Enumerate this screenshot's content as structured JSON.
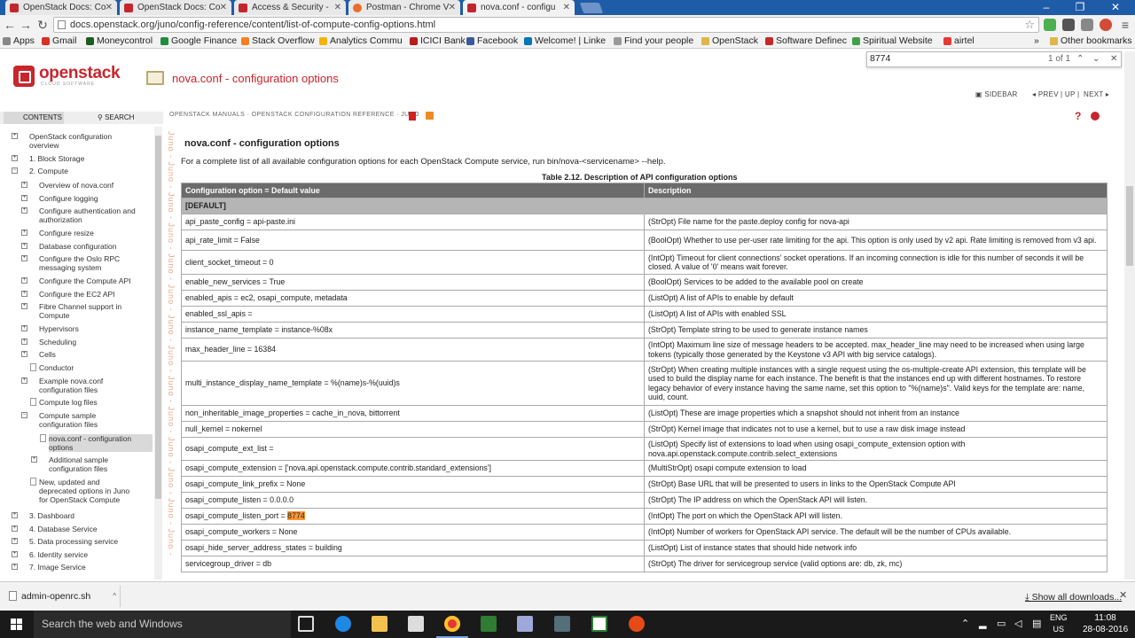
{
  "browser": {
    "tabs": [
      {
        "title": "OpenStack Docs: Co",
        "icon": "openstack-favicon"
      },
      {
        "title": "OpenStack Docs: Co",
        "icon": "openstack-favicon"
      },
      {
        "title": "Access & Security -",
        "icon": "openstack-favicon"
      },
      {
        "title": "Postman - Chrome V",
        "icon": "postman-favicon"
      },
      {
        "title": "nova.conf - configu",
        "icon": "openstack-favicon"
      }
    ],
    "url": "docs.openstack.org/juno/config-reference/content/list-of-compute-config-options.html",
    "bookmarks": [
      {
        "label": "Apps",
        "icon": "apps-grid-icon"
      },
      {
        "label": "Gmail",
        "icon": "gmail-icon"
      },
      {
        "label": "Moneycontrol",
        "icon": "moneycontrol-icon"
      },
      {
        "label": "Google Finance",
        "icon": "google-finance-icon"
      },
      {
        "label": "Stack Overflow",
        "icon": "stackoverflow-icon"
      },
      {
        "label": "Analytics Commu",
        "icon": "analytics-icon"
      },
      {
        "label": "ICICI Bank",
        "icon": "icici-icon"
      },
      {
        "label": "Facebook",
        "icon": "facebook-icon"
      },
      {
        "label": "Welcome! | Linke",
        "icon": "linkedin-icon"
      },
      {
        "label": "Find your people",
        "icon": "page-icon"
      },
      {
        "label": "OpenStack",
        "icon": "folder-icon"
      },
      {
        "label": "Software Definec",
        "icon": "software-icon"
      },
      {
        "label": "Spiritual Website",
        "icon": "spiritual-icon"
      },
      {
        "label": "airtel",
        "icon": "airtel-icon"
      }
    ],
    "other_bookmarks": "Other bookmarks",
    "more": "»",
    "find": {
      "query": "8774",
      "count": "1 of 1"
    }
  },
  "site": {
    "logo": "openstack",
    "logo_sub": "CLOUD SOFTWARE",
    "page_heading": "nova.conf - configuration options",
    "nav": {
      "sidebar": "SIDEBAR",
      "prev": "PREV",
      "up": "UP",
      "next": "NEXT"
    },
    "sidebar_tabs": {
      "contents": "CONTENTS",
      "search": "SEARCH"
    },
    "breadcrumbs": "OPENSTACK MANUALS  ·  OPENSTACK CONFIGURATION REFERENCE  ·  JUNO",
    "juno_watermark": "Juno - Juno - Juno - Juno - Juno - Juno - Juno - Juno - Juno - Juno - Juno - Juno - Juno - Juno - Juno - Juno -"
  },
  "sidebar": {
    "items": [
      {
        "label": "OpenStack configuration",
        "label2": "overview",
        "level": 0,
        "kind": "expand"
      },
      {
        "label": "1. Block Storage",
        "level": 0,
        "kind": "expand"
      },
      {
        "label": "2. Compute",
        "level": 0,
        "kind": "collapse"
      },
      {
        "label": "Overview of nova.conf",
        "level": 1,
        "kind": "expand"
      },
      {
        "label": "Configure logging",
        "level": 1,
        "kind": "expand"
      },
      {
        "label": "Configure authentication and",
        "label2": "authorization",
        "level": 1,
        "kind": "expand"
      },
      {
        "label": "Configure resize",
        "level": 1,
        "kind": "expand"
      },
      {
        "label": "Database configuration",
        "level": 1,
        "kind": "expand"
      },
      {
        "label": "Configure the Oslo RPC",
        "label2": "messaging system",
        "level": 1,
        "kind": "expand"
      },
      {
        "label": "Configure the Compute API",
        "level": 1,
        "kind": "expand"
      },
      {
        "label": "Configure the EC2 API",
        "level": 1,
        "kind": "expand"
      },
      {
        "label": "Fibre Channel support in",
        "label2": "Compute",
        "level": 1,
        "kind": "expand"
      },
      {
        "label": "Hypervisors",
        "level": 1,
        "kind": "expand"
      },
      {
        "label": "Scheduling",
        "level": 1,
        "kind": "expand"
      },
      {
        "label": "Cells",
        "level": 1,
        "kind": "expand"
      },
      {
        "label": "Conductor",
        "level": 1,
        "kind": "doc"
      },
      {
        "label": "Example nova.conf",
        "label2": "configuration files",
        "level": 1,
        "kind": "expand"
      },
      {
        "label": "Compute log files",
        "level": 1,
        "kind": "doc"
      },
      {
        "label": "Compute sample",
        "label2": "configuration files",
        "level": 1,
        "kind": "collapse"
      },
      {
        "label": "nova.conf - configuration",
        "label2": "options",
        "level": 2,
        "kind": "doc",
        "selected": true
      },
      {
        "label": "Additional sample",
        "label2": "configuration files",
        "level": 2,
        "kind": "expand"
      },
      {
        "label": "New, updated and",
        "label2": "deprecated options in Juno",
        "label3": "for OpenStack Compute",
        "level": 1,
        "kind": "doc"
      },
      {
        "label": "3. Dashboard",
        "level": 0,
        "kind": "expand"
      },
      {
        "label": "4. Database Service",
        "level": 0,
        "kind": "expand"
      },
      {
        "label": "5. Data processing service",
        "level": 0,
        "kind": "expand"
      },
      {
        "label": "6. Identity service",
        "level": 0,
        "kind": "expand"
      },
      {
        "label": "7. Image Service",
        "level": 0,
        "kind": "expand"
      }
    ]
  },
  "content": {
    "title": "nova.conf - configuration options",
    "intro": "For a complete list of all available configuration options for each OpenStack Compute service, run bin/nova-<servicename> --help.",
    "caption": "Table 2.12. Description of API configuration options",
    "headers": [
      "Configuration option = Default value",
      "Description"
    ],
    "section": "[DEFAULT]",
    "rows": [
      {
        "opt": "api_paste_config = api-paste.ini",
        "desc": "(StrOpt) File name for the paste.deploy config for nova-api"
      },
      {
        "opt": "api_rate_limit = False",
        "desc": "(BoolOpt) Whether to use per-user rate limiting for the api. This option is only used by v2 api. Rate limiting is removed from v3 api."
      },
      {
        "opt": "client_socket_timeout = 0",
        "desc": "(IntOpt) Timeout for client connections' socket operations. If an incoming connection is idle for this number of seconds it will be closed. A value of '0' means wait forever."
      },
      {
        "opt": "enable_new_services = True",
        "desc": "(BoolOpt) Services to be added to the available pool on create"
      },
      {
        "opt": "enabled_apis = ec2, osapi_compute, metadata",
        "desc": "(ListOpt) A list of APIs to enable by default"
      },
      {
        "opt": "enabled_ssl_apis =",
        "desc": "(ListOpt) A list of APIs with enabled SSL"
      },
      {
        "opt": "instance_name_template = instance-%08x",
        "desc": "(StrOpt) Template string to be used to generate instance names"
      },
      {
        "opt": "max_header_line = 16384",
        "desc": "(IntOpt) Maximum line size of message headers to be accepted. max_header_line may need to be increased when using large tokens (typically those generated by the Keystone v3 API with big service catalogs)."
      },
      {
        "opt": "multi_instance_display_name_template = %(name)s-%(uuid)s",
        "desc": "(StrOpt) When creating multiple instances with a single request using the os-multiple-create API extension, this template will be used to build the display name for each instance. The benefit is that the instances end up with different hostnames. To restore legacy behavior of every instance having the same name, set this option to \"%(name)s\". Valid keys for the template are: name, uuid, count."
      },
      {
        "opt": "non_inheritable_image_properties = cache_in_nova, bittorrent",
        "desc": "(ListOpt) These are image properties which a snapshot should not inherit from an instance"
      },
      {
        "opt": "null_kernel = nokernel",
        "desc": "(StrOpt) Kernel image that indicates not to use a kernel, but to use a raw disk image instead"
      },
      {
        "opt": "osapi_compute_ext_list =",
        "desc": "(ListOpt) Specify list of extensions to load when using osapi_compute_extension option with nova.api.openstack.compute.contrib.select_extensions"
      },
      {
        "opt": "osapi_compute_extension = ['nova.api.openstack.compute.contrib.standard_extensions']",
        "desc": "(MultiStrOpt) osapi compute extension to load"
      },
      {
        "opt": "osapi_compute_link_prefix = None",
        "desc": "(StrOpt) Base URL that will be presented to users in links to the OpenStack Compute API"
      },
      {
        "opt": "osapi_compute_listen = 0.0.0.0",
        "desc": "(StrOpt) The IP address on which the OpenStack API will listen."
      },
      {
        "opt": "osapi_compute_listen_port = ",
        "opt_highlight": "8774",
        "desc": "(IntOpt) The port on which the OpenStack API will listen."
      },
      {
        "opt": "osapi_compute_workers = None",
        "desc": "(IntOpt) Number of workers for OpenStack API service. The default will be the number of CPUs available."
      },
      {
        "opt": "osapi_hide_server_address_states = building",
        "desc": "(ListOpt) List of instance states that should hide network info"
      },
      {
        "opt": "servicegroup_driver = db",
        "desc": "(StrOpt) The driver for servicegroup service (valid options are: db, zk, mc)"
      }
    ]
  },
  "downloads": {
    "item": "admin-openrc.sh",
    "show_all": "Show all downloads..."
  },
  "taskbar": {
    "search_placeholder": "Search the web and Windows",
    "lang": "ENG",
    "region": "US",
    "time": "11:08",
    "date": "28-08-2016"
  },
  "colors": {
    "openstack_red": "#c8262d",
    "find_highlight": "#ff9632",
    "table_header": "#6b6b6b"
  }
}
